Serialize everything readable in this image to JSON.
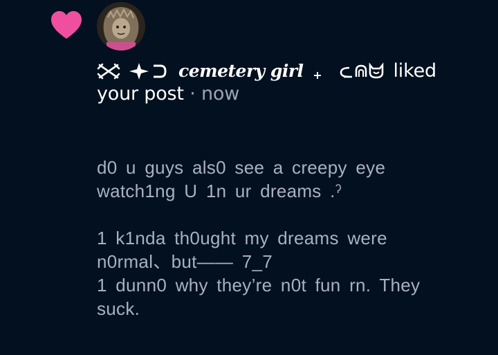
{
  "notification": {
    "icon": "heart-icon",
    "icon_color": "#f04fa0",
    "avatar_alt": "user avatar",
    "display_name": "cemetery girl",
    "action_text": "liked",
    "object_text": "your post",
    "separator": "·",
    "timestamp": "now"
  },
  "post": {
    "lines": [
      "d0 u guys als0 see a creepy eye",
      "watch1ng U 1n ur dreams .ˀ",
      "",
      "1 k1nda th0ught my dreams were",
      "n0rmal、but—— 7_7",
      "1 dunn0 why they’re n0t fun rn. They",
      "suck."
    ]
  },
  "colors": {
    "background": "#03101f",
    "heading_text": "#ffffff",
    "muted_text": "#9aa6b5",
    "post_text": "#a6b2c3"
  }
}
